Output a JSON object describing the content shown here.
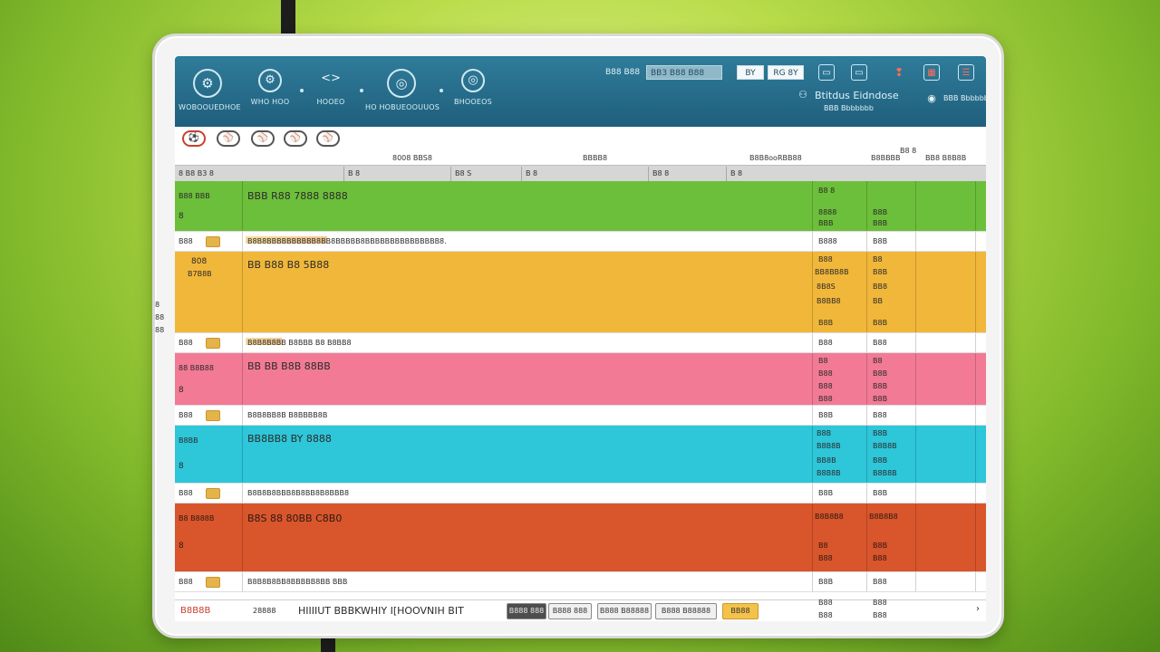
{
  "header": {
    "nav": [
      {
        "icon": "gear-icon",
        "label": "WOBOOUEDHOE"
      },
      {
        "icon": "gear-icon",
        "label": "WHO HOO"
      },
      {
        "icon": "code-icon",
        "label": "HOOEO"
      },
      {
        "icon": "globe-icon",
        "label": "HO HOBUEOOUUOS"
      },
      {
        "icon": "globe-icon",
        "label": "BHOOEOS"
      }
    ],
    "search_label": "B88 B88",
    "search_value": "BB3 B88 B88",
    "btn_a": "BY",
    "btn_b": "RG 8Y",
    "profile_title": "Btitdus Eidndose",
    "profile_sub": "BBB Bbbbbbb"
  },
  "toolbar": {
    "icons": [
      "ball-icon",
      "ball-icon",
      "ball-icon",
      "ball-icon",
      "ball-icon"
    ]
  },
  "columns": {
    "top_labels": [
      "8008 BBS8",
      "BBBB8",
      "B8B8ooRBB88",
      "B8BBBB",
      "BB8 B8B8B"
    ],
    "top_badge": "B8 8",
    "cells": [
      "8 B8 B3 8",
      "B 8",
      "B8 S",
      "B 8",
      "B8 8",
      "B 8"
    ]
  },
  "rows": [
    {
      "type": "main",
      "color": "green",
      "a": "B88 BBB",
      "a2": "8",
      "title": "BBB R88 7888 8888",
      "c": [
        "B8 8",
        "8888",
        "BBB"
      ],
      "d": [
        "B8B",
        "B8B"
      ]
    },
    {
      "type": "sub",
      "a": "B88",
      "text": "B8B8BBBBBBBBBB8BB8BBBBB8BBBBBBBBBBBBBBB8.",
      "c": "B888",
      "d": "B8B"
    },
    {
      "type": "main",
      "color": "orange",
      "a": "808",
      "a2": "B7B8B",
      "title": "BB B88 B8 5B88",
      "c": [
        "B88",
        "BB8BB8B",
        "8B8S",
        "B8BB8",
        "B8B"
      ],
      "d": [
        "B8",
        "B8B",
        "BB8",
        "BB",
        "B8B"
      ]
    },
    {
      "type": "sub",
      "a": "B88",
      "text": "B8B8B8BB B8BBB B8 B8BB8",
      "c": "B88",
      "d": "B88"
    },
    {
      "type": "main",
      "color": "pink",
      "a": "88 B8B88",
      "a2": "8",
      "title": "BB BB B8B 88BB",
      "c": [
        "B8",
        "B88",
        "B88",
        "B88"
      ],
      "d": [
        "B8",
        "B8B",
        "B8B",
        "B8B"
      ]
    },
    {
      "type": "sub",
      "a": "B88",
      "text": "B8B8BB8B B8BBBB8B",
      "c": "B8B",
      "d": "B88"
    },
    {
      "type": "main",
      "color": "cyan",
      "a": "B8BB",
      "a2": "8",
      "title": "BB8BB8 BY 8888",
      "c": [
        "B8B",
        "B8B8B",
        "BB8B",
        "B8B8B"
      ],
      "d": [
        "B8B",
        "B8B8B",
        "B8B",
        "B8B8B"
      ]
    },
    {
      "type": "sub",
      "a": "B88",
      "text": "B8B8B8BBB8B8BB8B8BBB8",
      "c": "B8B",
      "d": "B8B"
    },
    {
      "type": "main",
      "color": "rust",
      "a": "B8 B888B",
      "a2": "8",
      "title": "B8S 88 80BB C8B0",
      "c": [
        "B8B8B8",
        "B8",
        "B88"
      ],
      "d": [
        "B8B8B8",
        "B8B",
        "B88"
      ]
    },
    {
      "type": "sub",
      "a": "B88",
      "text": "B8B8B8BB8BBBBB8BB BBB",
      "c": "B8B",
      "d": "B88"
    }
  ],
  "footer": {
    "left": "B8B8B",
    "num": "28888",
    "text": "HIIIIUT BBBKWHIY I[HOOVNIH BIT",
    "buttons": [
      "B888 888",
      "B888 888",
      "B888 B88888",
      "BB88"
    ],
    "c": "B88",
    "d": "B88"
  },
  "side_nums": [
    "8",
    "88",
    "88"
  ],
  "colors": {
    "green": "#6cbf3a",
    "orange": "#f1b73a",
    "pink": "#f27a95",
    "cyan": "#2ec6d9",
    "rust": "#d9552c",
    "header": "#2f7c9a"
  }
}
